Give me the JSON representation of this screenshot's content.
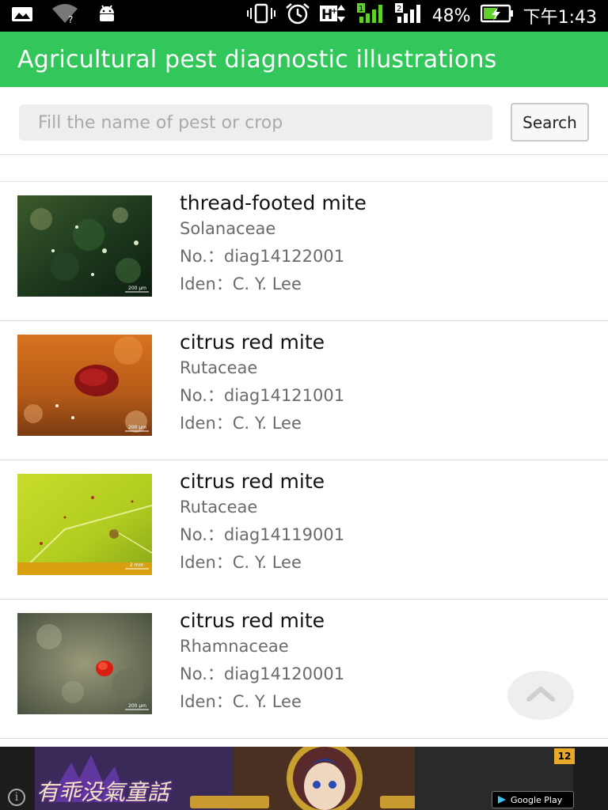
{
  "status_bar": {
    "battery_percent": "48%",
    "time": "下午1:43",
    "icons": [
      "image-notification-icon",
      "wifi-unknown-icon",
      "android-icon",
      "vibrate-icon",
      "alarm-icon",
      "hplus-data-icon",
      "sim1-signal-icon",
      "sim2-signal-icon",
      "battery-charging-icon"
    ]
  },
  "app_bar": {
    "title": "Agricultural pest diagnostic illustrations",
    "color": "#33c65b"
  },
  "search": {
    "placeholder": "Fill the name of pest or crop",
    "value": "",
    "button_label": "Search"
  },
  "items": [
    {
      "name": "thread-footed mite",
      "family": "Solanaceae",
      "number": "No.：diag14122001",
      "identifier": "Iden：C. Y. Lee",
      "scale_label": "200 μm",
      "image": "leaf-closeup-green"
    },
    {
      "name": "citrus red mite",
      "family": "Rutaceae",
      "number": "No.：diag14121001",
      "identifier": "Iden：C. Y. Lee",
      "scale_label": "200 μm",
      "image": "red-mite-orange-bark"
    },
    {
      "name": "citrus red mite",
      "family": "Rutaceae",
      "number": "No.：diag14119001",
      "identifier": "Iden：C. Y. Lee",
      "scale_label": "2 mm",
      "image": "yellow-leaf-damage"
    },
    {
      "name": "citrus red mite",
      "family": "Rhamnaceae",
      "number": "No.：diag14120001",
      "identifier": "Iden：C. Y. Lee",
      "scale_label": "200 μm",
      "image": "red-mite-gray-leaf"
    }
  ],
  "scroll_top_button": {
    "icon": "chevron-up-icon"
  },
  "ad_banner": {
    "slogan": "有乖没氣童話",
    "rating": "12",
    "store_badge": "Google Play",
    "info_icon": "info-icon"
  }
}
